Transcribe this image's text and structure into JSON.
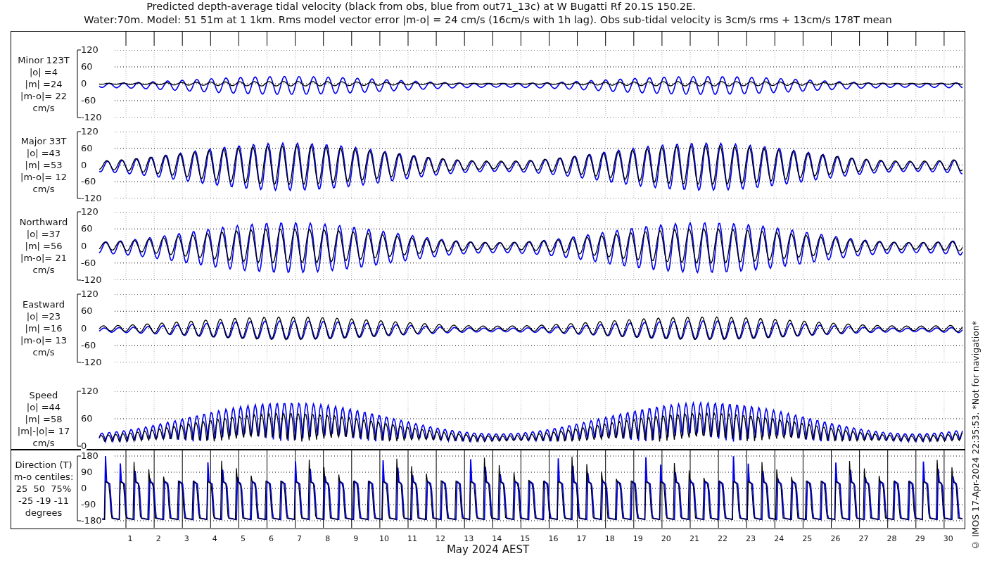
{
  "title_lines": [
    "Predicted depth-average tidal velocity (black from obs, blue from out71_13c) at W Bugatti Rf 20.1S 150.2E.",
    "Water:70m. Model: 51 51m at 1 1km. Rms model vector error |m-o| = 24 cm/s (16cm/s with 1h lag). Obs sub-tidal velocity is 3cm/s rms + 13cm/s 178T mean"
  ],
  "panels": [
    {
      "kind": "velocity",
      "label_lines": [
        "Minor 123T",
        "|o| =4",
        "|m| =24",
        "|m-o|= 22",
        "cm/s"
      ],
      "yticks": [
        "120",
        "60",
        "0",
        "-60",
        "-120"
      ]
    },
    {
      "kind": "velocity",
      "label_lines": [
        "Major 33T",
        "|o| =43",
        "|m| =53",
        "|m-o|= 12",
        "cm/s"
      ],
      "yticks": [
        "120",
        "60",
        "0",
        "-60",
        "-120"
      ]
    },
    {
      "kind": "velocity",
      "label_lines": [
        "Northward",
        "|o| =37",
        "|m| =56",
        "|m-o|= 21",
        "cm/s"
      ],
      "yticks": [
        "120",
        "60",
        "0",
        "-60",
        "-120"
      ]
    },
    {
      "kind": "velocity",
      "label_lines": [
        "Eastward",
        "|o| =23",
        "|m| =16",
        "|m-o|= 13",
        "cm/s"
      ],
      "yticks": [
        "120",
        "60",
        "0",
        "-60",
        "-120"
      ]
    },
    {
      "kind": "speed",
      "label_lines": [
        "Speed",
        "|o| =44",
        "|m| =58",
        "|m|-|o|= 17",
        "cm/s"
      ],
      "yticks": [
        "120",
        "60",
        "0"
      ]
    },
    {
      "kind": "direction",
      "label_lines": [
        "Direction (T)",
        "m-o centiles:",
        "25  50  75%",
        "-25 -19 -11",
        "degrees"
      ],
      "yticks": [
        "180",
        "90",
        "0",
        "-90",
        "-180"
      ]
    }
  ],
  "x_axis": {
    "day_labels": [
      "1",
      "2",
      "3",
      "4",
      "5",
      "6",
      "7",
      "8",
      "9",
      "10",
      "11",
      "12",
      "13",
      "14",
      "15",
      "16",
      "17",
      "18",
      "19",
      "20",
      "21",
      "22",
      "23",
      "24",
      "25",
      "26",
      "27",
      "28",
      "29",
      "30"
    ],
    "label": "May 2024 AEST"
  },
  "credit": "© IMOS 17-Apr-2024 22:35:53. *Not for navigation*"
}
